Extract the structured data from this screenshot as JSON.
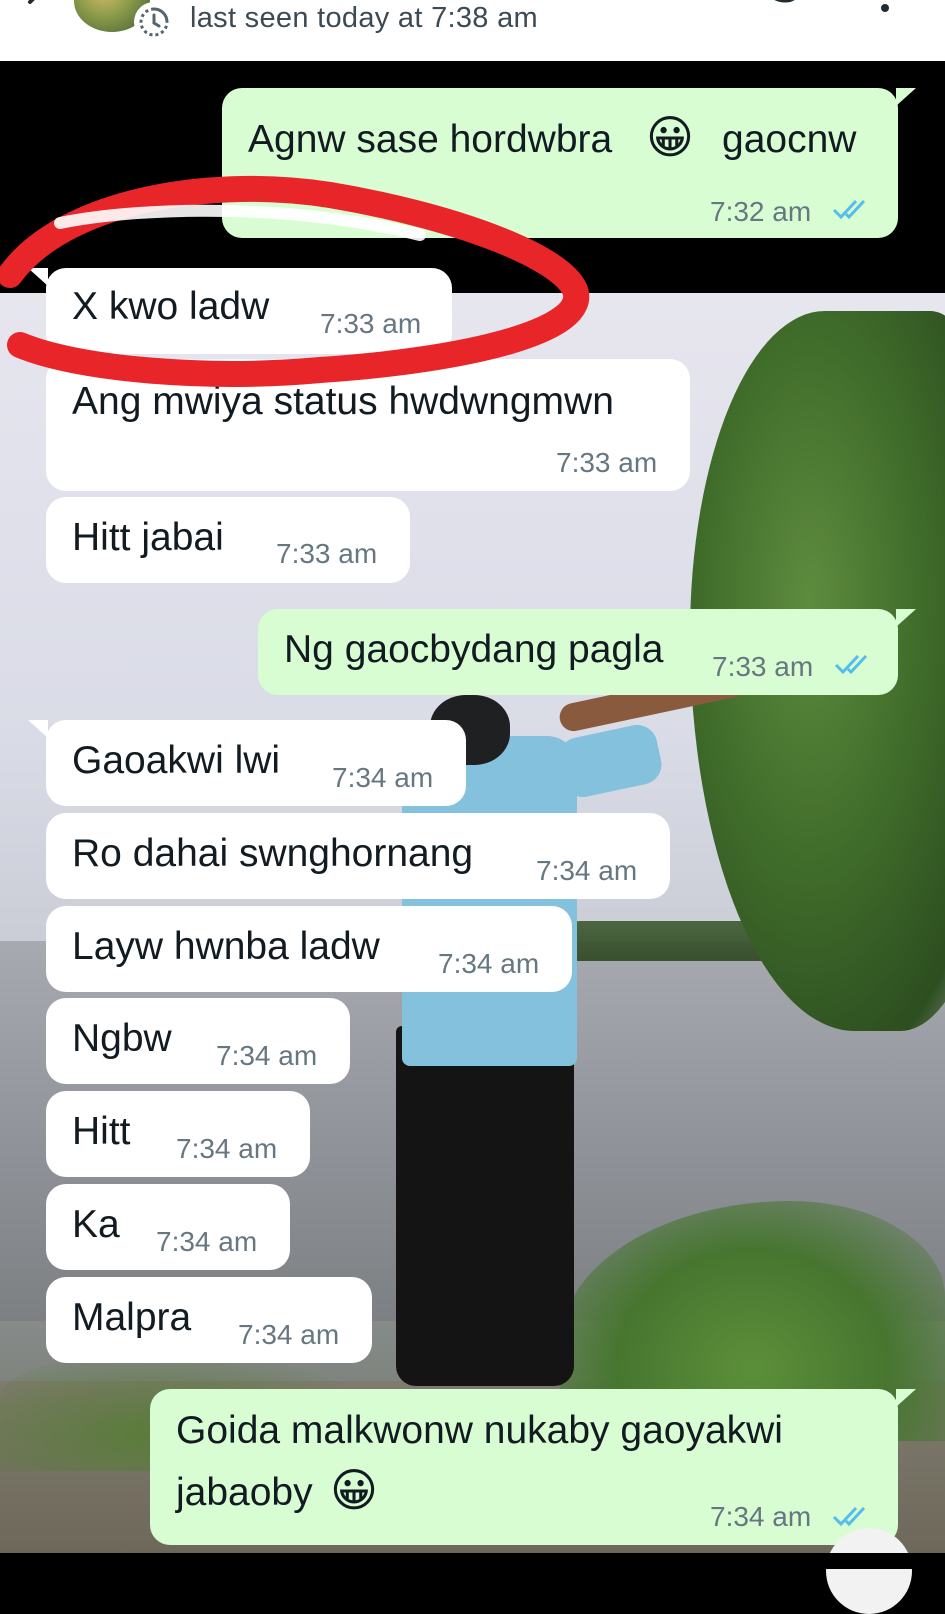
{
  "header": {
    "status_text": "last seen today at 7:38 am",
    "icons": [
      "back-arrow-icon",
      "avatar",
      "disappearing-timer-icon",
      "video-call-icon",
      "more-options-icon"
    ]
  },
  "messages": [
    {
      "direction": "outgoing",
      "text": "Agnw sase hordwbra",
      "emoji": "😀",
      "text_after": "gaocnw",
      "time": "7:32 am",
      "status": "read"
    },
    {
      "direction": "incoming",
      "text": "X kwo ladw",
      "time": "7:33 am",
      "highlighted": true
    },
    {
      "direction": "incoming",
      "text": "Ang mwiya status hwdwngmwn",
      "time": "7:33 am"
    },
    {
      "direction": "incoming",
      "text": "Hitt jabai",
      "time": "7:33 am"
    },
    {
      "direction": "outgoing",
      "text": "Ng gaocbydang pagla",
      "time": "7:33 am",
      "status": "read"
    },
    {
      "direction": "incoming",
      "text": "Gaoakwi lwi",
      "time": "7:34 am"
    },
    {
      "direction": "incoming",
      "text": "Ro dahai swnghornang",
      "time": "7:34 am"
    },
    {
      "direction": "incoming",
      "text": "Layw hwnba ladw",
      "time": "7:34 am"
    },
    {
      "direction": "incoming",
      "text": "Ngbw",
      "time": "7:34 am"
    },
    {
      "direction": "incoming",
      "text": "Hitt",
      "time": "7:34 am"
    },
    {
      "direction": "incoming",
      "text": "Ka",
      "time": "7:34 am"
    },
    {
      "direction": "incoming",
      "text": "Malpra",
      "time": "7:34 am"
    },
    {
      "direction": "outgoing",
      "text_line1": "Goida malkwonw nukaby gaoyakwi",
      "text_line2": "jabaoby",
      "emoji": "😀",
      "time": "7:34 am",
      "status": "read"
    }
  ],
  "colors": {
    "incoming_bubble": "#ffffff",
    "outgoing_bubble": "#d9fdd3",
    "read_ticks": "#53bdeb",
    "annotation": "#e8262a"
  }
}
